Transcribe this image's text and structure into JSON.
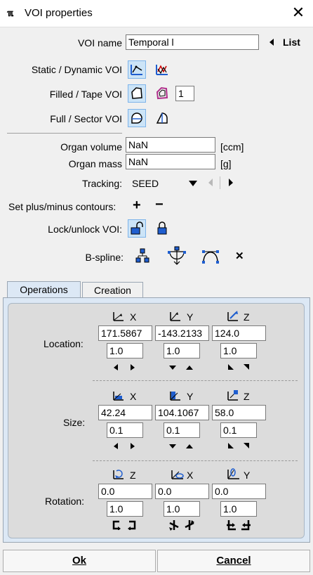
{
  "window": {
    "title": "VOI properties",
    "app_icon": "pmod-logo-icon",
    "app_icon_text": "ℼ",
    "close_glyph": "✕"
  },
  "voi_name": {
    "label": "VOI name",
    "value": "Temporal l",
    "list_label": "List"
  },
  "static_dynamic": {
    "label": "Static / Dynamic VOI"
  },
  "filled_tape": {
    "label": "Filled / Tape VOI",
    "tape_value": "1"
  },
  "full_sector": {
    "label": "Full / Sector VOI"
  },
  "organ_volume": {
    "label": "Organ volume",
    "value": "NaN",
    "unit": "[ccm]"
  },
  "organ_mass": {
    "label": "Organ mass",
    "value": "NaN",
    "unit": "[g]"
  },
  "tracking": {
    "label": "Tracking:",
    "value": "SEED"
  },
  "plus_minus": {
    "label": "Set plus/minus contours:",
    "plus": "+",
    "minus": "−"
  },
  "lock": {
    "label": "Lock/unlock VOI:"
  },
  "bspline": {
    "label": "B-spline:",
    "remove": "✕"
  },
  "tabs": [
    {
      "label": "Operations",
      "active": true
    },
    {
      "label": "Creation",
      "active": false
    }
  ],
  "location": {
    "label": "Location:",
    "axes": [
      "X",
      "Y",
      "Z"
    ],
    "values": [
      "171.5867",
      "-143.2133",
      "124.0"
    ],
    "steps": [
      "1.0",
      "1.0",
      "1.0"
    ]
  },
  "size": {
    "label": "Size:",
    "axes": [
      "X",
      "Y",
      "Z"
    ],
    "values": [
      "42.24",
      "104.1067",
      "58.0"
    ],
    "steps": [
      "0.1",
      "0.1",
      "0.1"
    ]
  },
  "rotation": {
    "label": "Rotation:",
    "axes": [
      "Z",
      "X",
      "Y"
    ],
    "values": [
      "0.0",
      "0.0",
      "0.0"
    ],
    "steps": [
      "1.0",
      "1.0",
      "1.0"
    ]
  },
  "buttons": {
    "ok": "Ok",
    "cancel": "Cancel"
  },
  "colors": {
    "selected_bg": "#cce4f7",
    "icon_blue": "#1f5ecf",
    "panel_bg": "#dce8f5"
  }
}
